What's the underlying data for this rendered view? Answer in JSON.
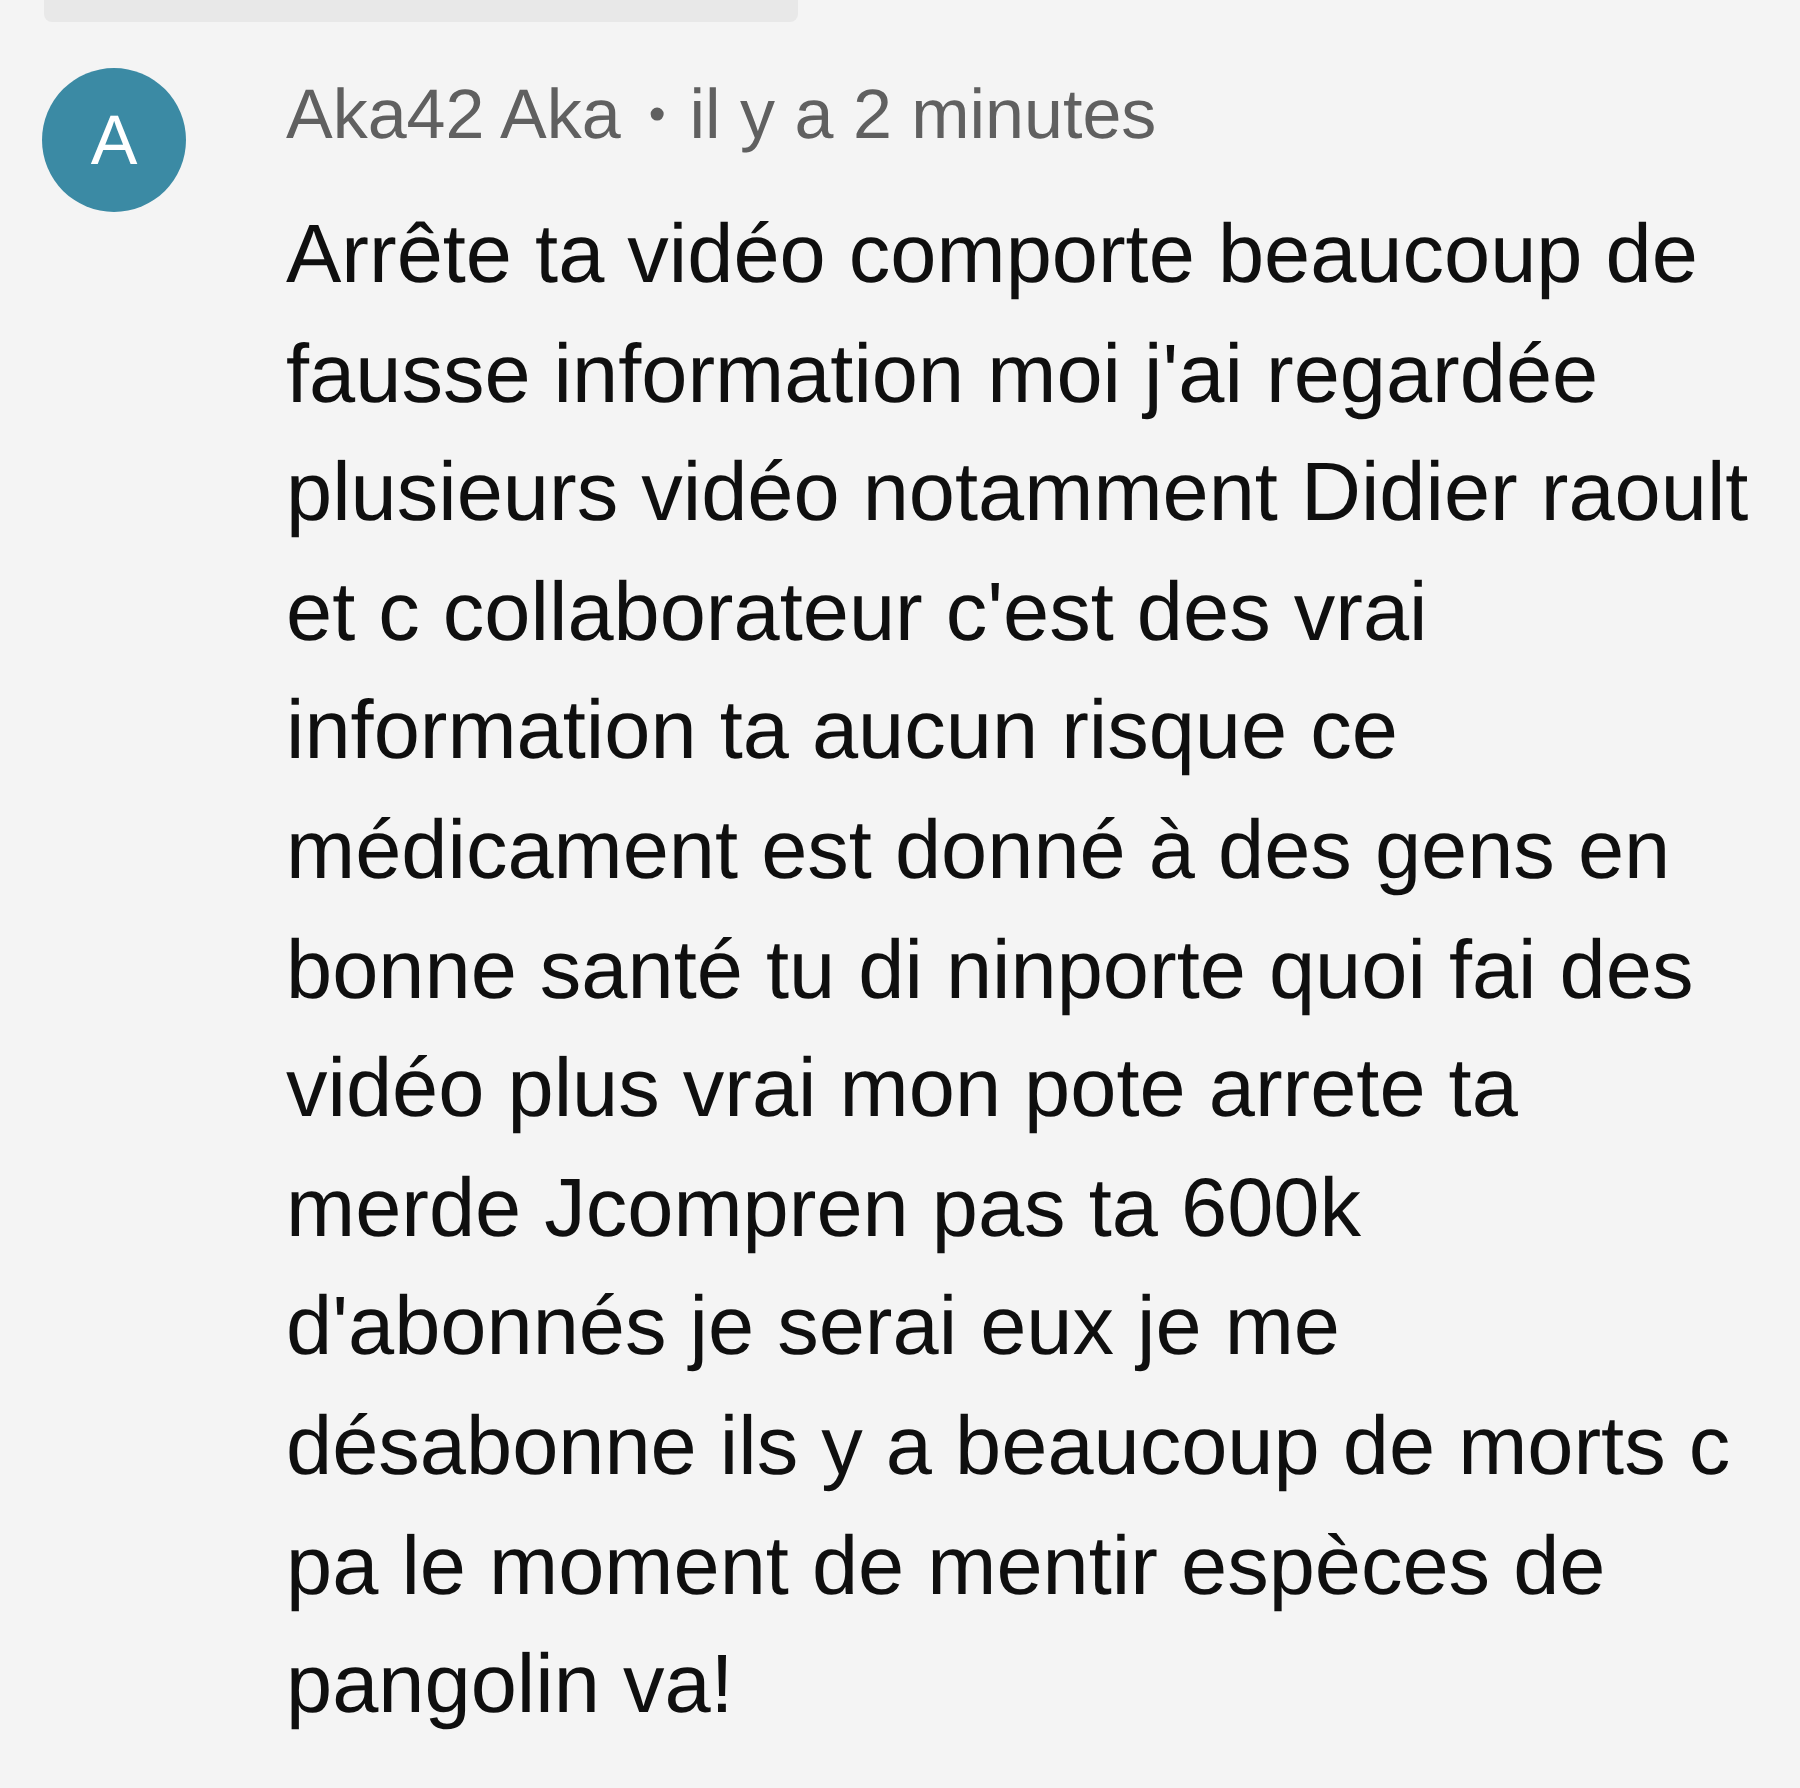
{
  "comment": {
    "avatar_letter": "A",
    "author": "Aka42 Aka",
    "separator": "•",
    "time": "il y a 2 minutes",
    "text": "Arrête ta vidéo comporte beaucoup de fausse information moi j'ai regardée plusieurs vidéo notamment Didier raoult et c collaborateur c'est des vrai information ta aucun risque ce médicament est donné à des gens en bonne santé tu di ninporte quoi fai des vidéo plus vrai mon pote arrete ta merde Jcompren pas ta 600k d'abonnés je serai eux je me désabonne ils y a beaucoup de morts c pa le moment de mentir espèces de pangolin va!"
  }
}
